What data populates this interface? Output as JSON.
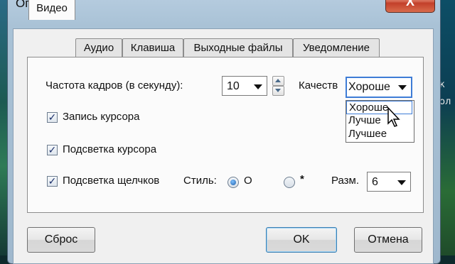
{
  "window": {
    "title": "Опции",
    "close_glyph": "X"
  },
  "tabs": [
    {
      "label": "Видео",
      "active": true
    },
    {
      "label": "Аудио",
      "active": false
    },
    {
      "label": "Клавиша",
      "active": false
    },
    {
      "label": "Выходные файлы",
      "active": false
    },
    {
      "label": "Уведомление",
      "active": false
    }
  ],
  "video": {
    "fps_label": "Частота кадров (в секунду):",
    "fps_value": "10",
    "quality_label": "Качеств",
    "quality_value": "Хороше",
    "quality_options": [
      "Хороше",
      "Лучше",
      "Лучшее"
    ],
    "quality_highlighted": "Хороше",
    "record_cursor_label": "Запись курсора",
    "record_cursor_checked": true,
    "highlight_cursor_label": "Подсветка курсора",
    "highlight_cursor_checked": true,
    "highlight_clicks_label": "Подсветка щелчков",
    "highlight_clicks_checked": true,
    "style_label": "Стиль:",
    "style_option_1": "O",
    "style_option_2": "*",
    "style_selected": "O",
    "size_label": "Разм.",
    "size_value": "6"
  },
  "buttons": {
    "reset": "Сброс",
    "ok": "OK",
    "cancel": "Отмена"
  },
  "background_right_text": [
    "к",
    "ол"
  ],
  "colors": {
    "selection_border": "#3e7cd6",
    "close_button": "#c2402a"
  }
}
